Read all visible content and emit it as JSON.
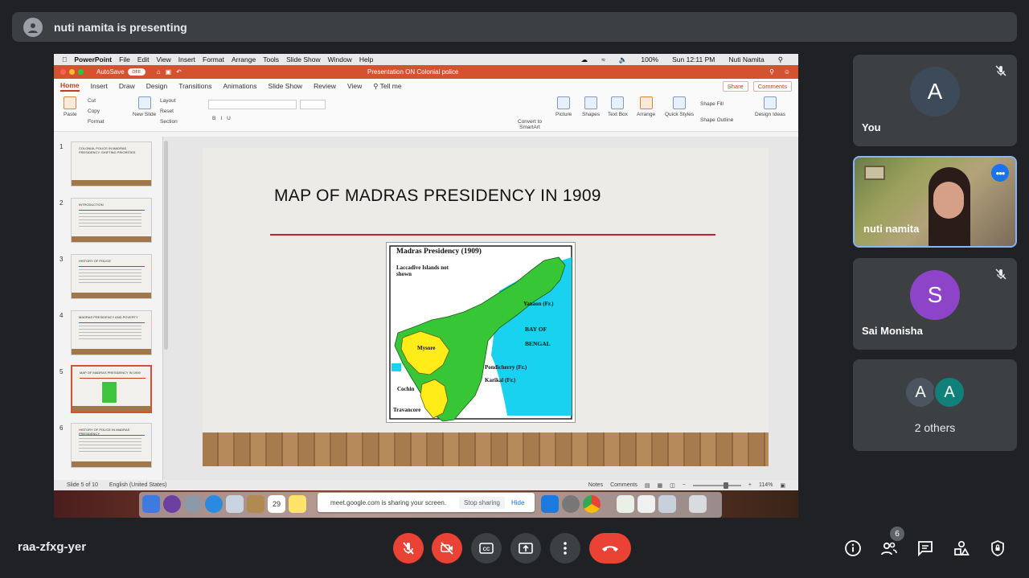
{
  "presenting_bar": {
    "text": "nuti namita is presenting"
  },
  "mac_menu": {
    "app": "PowerPoint",
    "items": [
      "File",
      "Edit",
      "View",
      "Insert",
      "Format",
      "Arrange",
      "Tools",
      "Slide Show",
      "Window",
      "Help"
    ],
    "battery": "100%",
    "clock": "Sun 12:11 PM",
    "user": "Nuti Namita"
  },
  "ppt": {
    "autosave_label": "AutoSave",
    "autosave_state": "OFF",
    "doc_title": "Presentation ON Colonial police",
    "tabs": [
      "Home",
      "Insert",
      "Draw",
      "Design",
      "Transitions",
      "Animations",
      "Slide Show",
      "Review",
      "View"
    ],
    "tell_me": "Tell me",
    "share": "Share",
    "comments": "Comments",
    "ribbon": {
      "paste": "Paste",
      "cut": "Cut",
      "copy": "Copy",
      "format": "Format",
      "new_slide": "New Slide",
      "layout": "Layout",
      "reset": "Reset",
      "section": "Section",
      "convert": "Convert to SmartArt",
      "picture": "Picture",
      "shapes": "Shapes",
      "text_box": "Text Box",
      "arrange": "Arrange",
      "quick_styles": "Quick Styles",
      "shape_fill": "Shape Fill",
      "shape_outline": "Shape Outline",
      "design_ideas": "Design Ideas"
    },
    "thumbnails": [
      {
        "num": "1",
        "title": "COLONIAL POLICE IN MADRAS PRESIDENCY: SHIFTING PRIORITIES"
      },
      {
        "num": "2",
        "title": "INTRODUCTION"
      },
      {
        "num": "3",
        "title": "HISTORY OF POLICE"
      },
      {
        "num": "4",
        "title": "MADRAS PRESIDENCY AND POVERTY"
      },
      {
        "num": "5",
        "title": "MAP OF MADRAS PRESIDENCY IN 1909"
      },
      {
        "num": "6",
        "title": "HISTORY OF POLICE IN MADRAS PRESIDENCY"
      }
    ],
    "slide": {
      "title": "MAP OF MADRAS PRESIDENCY IN 1909",
      "map": {
        "heading": "Madras Presidency (1909)",
        "note": "Laccadive Islands not shown",
        "labels": [
          "Yanaon (Fr.)",
          "BAY OF",
          "BENGAL",
          "Mysore",
          "Pondicherry (Fr.)",
          "Karikal (Fr.)",
          "Cochin",
          "Travancore"
        ]
      }
    },
    "status": {
      "slide_of": "Slide 5 of 10",
      "language": "English (United States)",
      "notes": "Notes",
      "comments": "Comments",
      "zoom": "114%"
    }
  },
  "share_notice": {
    "text": "meet.google.com is sharing your screen.",
    "stop": "Stop sharing",
    "hide": "Hide"
  },
  "participants": [
    {
      "name": "You",
      "initial": "A",
      "color": "#3c4a5a"
    },
    {
      "name": "nuti namita"
    },
    {
      "name": "Sai Monisha",
      "initial": "S",
      "color": "#8e44c9"
    },
    {
      "name": "2 others",
      "initials": [
        "A",
        "A"
      ],
      "colors": [
        "#4a5560",
        "#12807a"
      ]
    }
  ],
  "meeting_code": "raa-zfxg-yer",
  "participant_count": "6"
}
